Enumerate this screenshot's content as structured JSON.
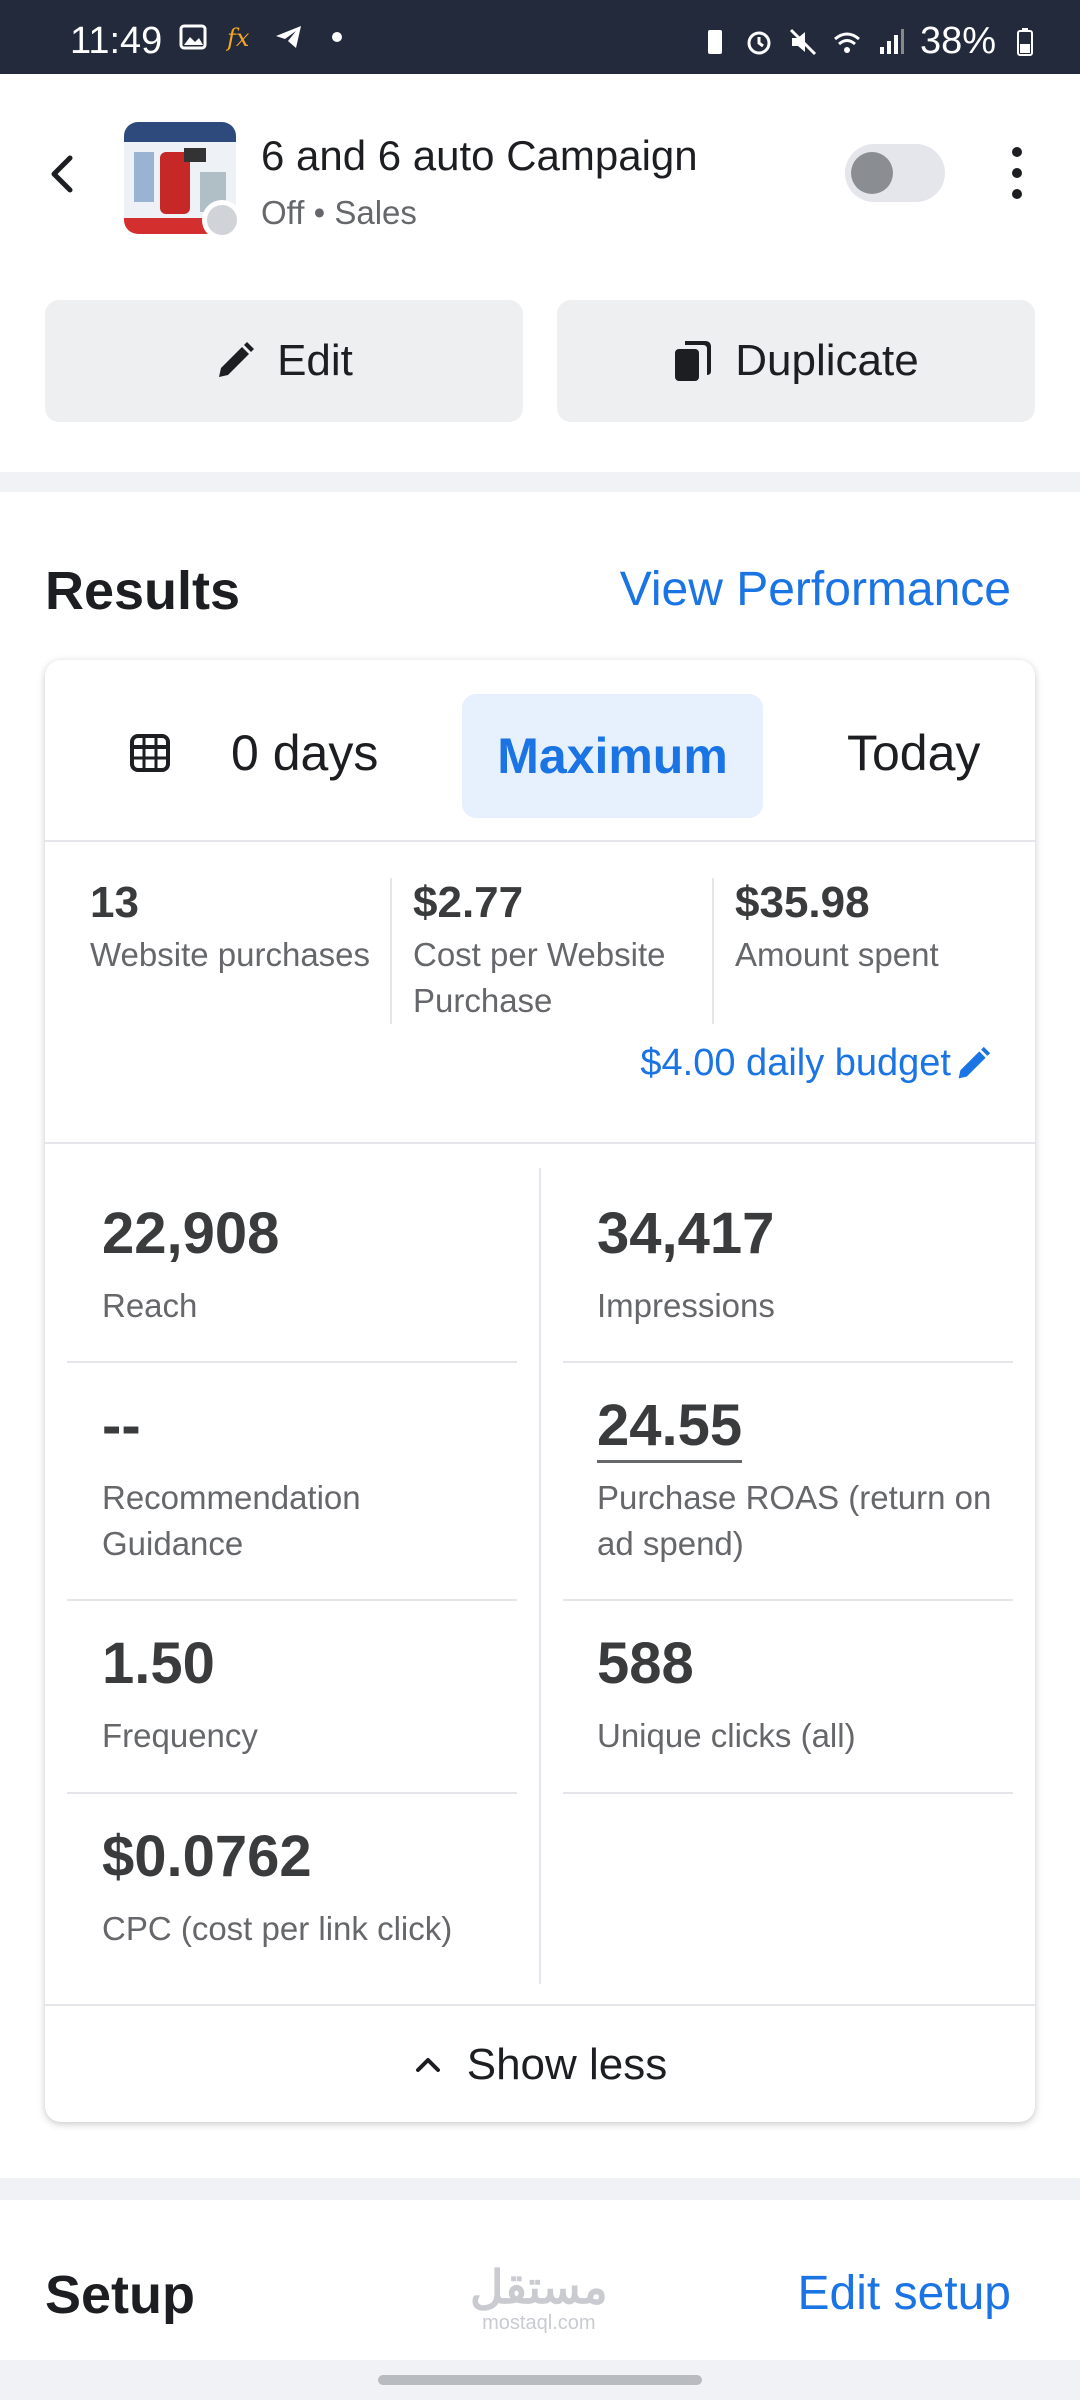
{
  "status_bar": {
    "time": "11:49",
    "battery": "38%",
    "left_icons": [
      "image-icon",
      "fx-icon",
      "telegram-icon",
      "dot-icon"
    ],
    "right_icons": [
      "battery-saver-icon",
      "alarm-icon",
      "mute-icon",
      "wifi-icon",
      "signal-icon",
      "battery-icon"
    ]
  },
  "header": {
    "title": "6 and 6 auto Campaign",
    "status": "Off",
    "objective": "Sales",
    "toggle_on": false
  },
  "actions": {
    "edit_label": "Edit",
    "duplicate_label": "Duplicate"
  },
  "results": {
    "title": "Results",
    "view_performance": "View Performance",
    "tabs": {
      "days": "0 days",
      "maximum": "Maximum",
      "today": "Today",
      "selected": "Maximum"
    },
    "summary": [
      {
        "value": "13",
        "label": "Website purchases"
      },
      {
        "value": "$2.77",
        "label": "Cost per Website Purchase"
      },
      {
        "value": "$35.98",
        "label": "Amount spent"
      }
    ],
    "budget": "$4.00 daily budget",
    "metrics_left": [
      {
        "value": "22,908",
        "label": "Reach"
      },
      {
        "value": "--",
        "label": "Recommendation Guidance"
      },
      {
        "value": "1.50",
        "label": "Frequency"
      },
      {
        "value": "$0.0762",
        "label": "CPC (cost per link click)"
      }
    ],
    "metrics_right": [
      {
        "value": "34,417",
        "label": "Impressions"
      },
      {
        "value": "24.55",
        "label": "Purchase ROAS (return on ad spend)"
      },
      {
        "value": "588",
        "label": "Unique clicks (all)"
      }
    ],
    "show_less": "Show less"
  },
  "setup": {
    "title": "Setup",
    "edit_setup": "Edit setup"
  },
  "watermark": {
    "arabic": "مستقل",
    "latin": "mostaql.com"
  },
  "colors": {
    "accent": "#1b74e4",
    "status_bar": "#222a3b",
    "background": "#f0f2f5"
  }
}
